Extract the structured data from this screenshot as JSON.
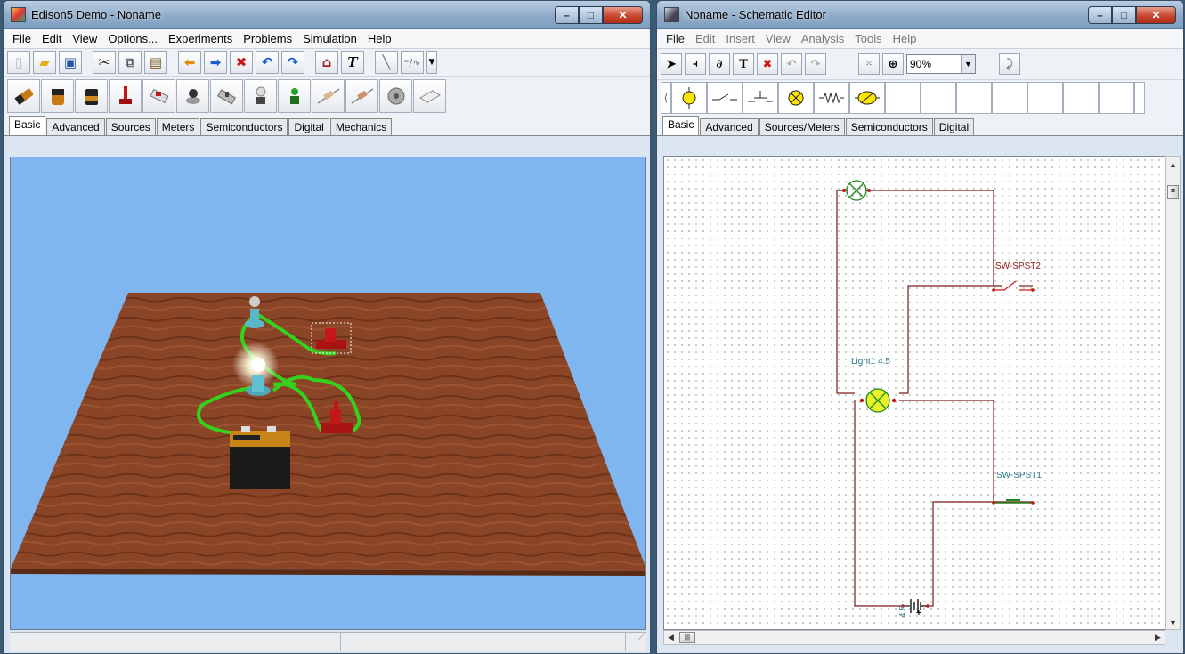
{
  "left_window": {
    "title": "Edison5 Demo - Noname",
    "menu": [
      "File",
      "Edit",
      "View",
      "Options...",
      "Experiments",
      "Problems",
      "Simulation",
      "Help"
    ],
    "toolbar_icons": [
      "new-icon",
      "open-icon",
      "save-icon",
      "cut-icon",
      "copy-icon",
      "paste-icon",
      "back-arrow-icon",
      "forward-arrow-icon",
      "delete-icon",
      "undo-icon",
      "redo-icon",
      "home-icon",
      "text-icon",
      "probe-icon",
      "meter-icon"
    ],
    "part_icons": [
      "battery-aa-icon",
      "battery-d-icon",
      "battery-9v-icon",
      "switch-lever-icon",
      "switch-toggle-icon",
      "push-button-icon",
      "switch-slide-icon",
      "lamp-socket-icon",
      "led-icon",
      "resistor-icon",
      "resistor-2-icon",
      "motor-icon",
      "breadboard-icon"
    ],
    "tabs": [
      "Basic",
      "Advanced",
      "Sources",
      "Meters",
      "Semiconductors",
      "Digital",
      "Mechanics"
    ],
    "active_tab": "Basic"
  },
  "right_window": {
    "title": "Noname - Schematic Editor",
    "menu": [
      "File",
      "Edit",
      "Insert",
      "View",
      "Analysis",
      "Tools",
      "Help"
    ],
    "toolbar": {
      "zoom_value": "90%"
    },
    "tabs": [
      "Basic",
      "Advanced",
      "Sources/Meters",
      "Semiconductors",
      "Digital"
    ],
    "active_tab": "Basic",
    "schematic": {
      "switch_top_label": "SW-SPST2",
      "light_label": "Light1 4.5",
      "switch_bottom_label": "SW-SPST1",
      "battery_value": "4.5",
      "battery_polarity": "+"
    }
  },
  "colors": {
    "wire": "#7a1a1a",
    "lamp": "#1e8a1e",
    "label_red": "#8b1a1a",
    "label_teal": "#2a7a8a",
    "viewport_sky": "#7fb6f0",
    "table_wood": "#8a4527"
  }
}
